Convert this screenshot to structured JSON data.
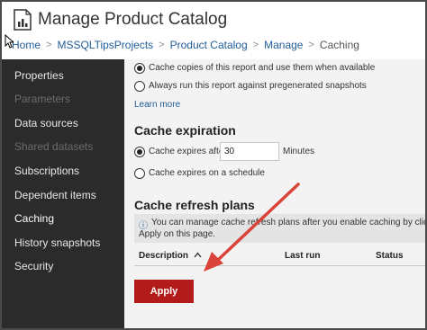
{
  "header": {
    "title": "Manage Product Catalog",
    "breadcrumb": [
      "Home",
      "MSSQLTipsProjects",
      "Product Catalog",
      "Manage",
      "Caching"
    ],
    "separator": ">"
  },
  "sidebar": {
    "items": [
      {
        "label": "Properties",
        "state": "enabled"
      },
      {
        "label": "Parameters",
        "state": "disabled"
      },
      {
        "label": "Data sources",
        "state": "enabled"
      },
      {
        "label": "Shared datasets",
        "state": "disabled"
      },
      {
        "label": "Subscriptions",
        "state": "enabled"
      },
      {
        "label": "Dependent items",
        "state": "enabled"
      },
      {
        "label": "Caching",
        "state": "active"
      },
      {
        "label": "History snapshots",
        "state": "enabled"
      },
      {
        "label": "Security",
        "state": "enabled"
      }
    ]
  },
  "cache_options": {
    "option1": "Cache copies of this report and use them when available",
    "option1_checked": true,
    "option2": "Always run this report against pregenerated snapshots",
    "option2_checked": false,
    "learn_more": "Learn more"
  },
  "cache_expiration": {
    "title": "Cache expiration",
    "option1_label": "Cache expires after",
    "option1_checked": true,
    "minutes_value": "30",
    "minutes_unit": "Minutes",
    "option2_label": "Cache expires on a schedule",
    "option2_checked": false
  },
  "refresh_plans": {
    "title": "Cache refresh plans",
    "info_icon": "ⓘ",
    "info_line1": "You can manage cache refresh plans after you enable caching by clicking",
    "info_line2": "Apply on this page.",
    "columns": [
      "Description",
      "Last run",
      "Status"
    ],
    "sort_indicator": "^"
  },
  "apply_label": "Apply",
  "colors": {
    "sidebar_bg": "#2b2b2b",
    "content_bg": "#f3f3f3",
    "apply_button": "#b31b1b",
    "annotation_arrow": "#d9433a",
    "link": "#1f5c99"
  },
  "icons": {
    "title_icon": "report-chart-icon",
    "cursor": "mouse-cursor-icon"
  }
}
